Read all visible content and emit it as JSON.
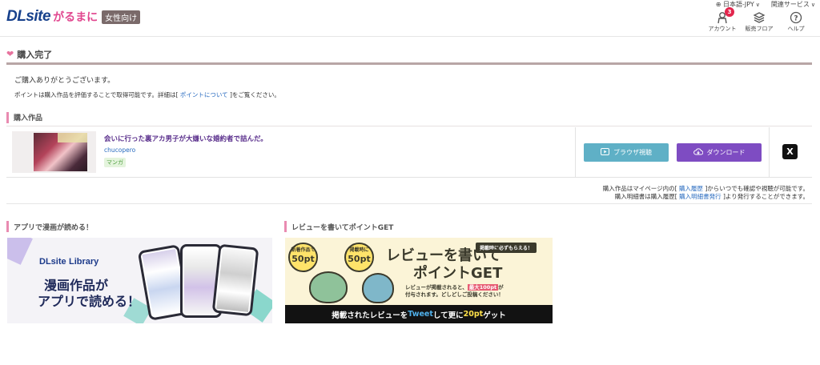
{
  "header": {
    "logo_main": "DLsite",
    "logo_sub": "がるまに",
    "logo_tag": "女性向け",
    "lang": "日本語-JPY",
    "services": "関連サービス",
    "nav": [
      {
        "label": "アカウント",
        "badge": "3"
      },
      {
        "label": "販売フロア"
      },
      {
        "label": "ヘルプ"
      }
    ]
  },
  "page": {
    "title": "購入完了",
    "thanks": "ご購入ありがとうございます。",
    "point_note_pre": "ポイントは購入作品を評価することで取得可能です。詳細は[ ",
    "point_note_link": "ポイントについて",
    "point_note_post": " ]をご覧ください。"
  },
  "purchased": {
    "section_title": "購入作品",
    "product": {
      "title": "会いに行った裏アカ男子が大嫌いな婚約者で詰んだ。",
      "author": "chucopero",
      "genre": "マンガ"
    },
    "browser_button": "ブラウザ視聴",
    "download_button": "ダウンロード",
    "share_icon": "X"
  },
  "notes": {
    "line1_pre": "購入作品はマイページ内の[ ",
    "line1_link": "購入履歴",
    "line1_post": " ]からいつでも確認や視聴が可能です。",
    "line2_pre": "購入明細書は購入履歴[ ",
    "line2_link": "購入明細書発行",
    "line2_post": " ]より発行することができます。"
  },
  "promo_app": {
    "section_title": "アプリで漫画が読める！",
    "logo": "DLsite",
    "logo_suffix": "Library",
    "line1": "漫画作品が",
    "line2": "アプリで読める！"
  },
  "promo_review": {
    "section_title": "レビューを書いてポイントGET",
    "badge_left_top": "新着作品で",
    "badge_left_value": "50pt",
    "badge_right_top": "掲載時に",
    "badge_right_value": "50pt",
    "tag": "掲載時に必ずもらえる！",
    "headline1": "レビューを書いて",
    "headline2": "ポイントGET",
    "desc1_pre": "レビューが掲載されると、",
    "desc1_hl": "最大100pt",
    "desc1_post": "が",
    "desc2": "付与されます。どしどしご投稿ください！",
    "stripe_pre": "掲載されたレビューを",
    "stripe_blue": "Tweet",
    "stripe_mid": "して更に",
    "stripe_yellow": "20pt",
    "stripe_post": "ゲット"
  }
}
